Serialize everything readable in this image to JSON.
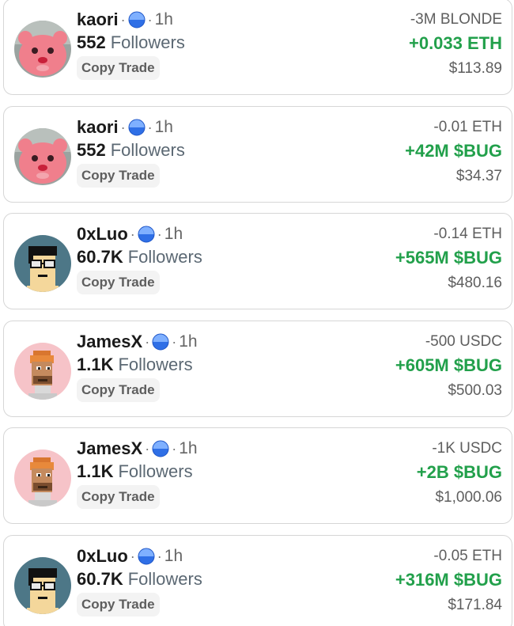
{
  "colors": {
    "positive": "#22a04b",
    "muted": "#5e5e5e",
    "verified_badge": "#2f6fe6"
  },
  "trades": [
    {
      "avatar": "kaori-pink-creature",
      "username": "kaori",
      "separator": "·",
      "time": "1h",
      "followers_count": "552",
      "followers_label": "Followers",
      "copy_label": "Copy Trade",
      "sold": "-3M BLONDE",
      "bought": "+0.033 ETH",
      "usd": "$113.89"
    },
    {
      "avatar": "kaori-pink-creature",
      "username": "kaori",
      "separator": "·",
      "time": "1h",
      "followers_count": "552",
      "followers_label": "Followers",
      "copy_label": "Copy Trade",
      "sold": "-0.01 ETH",
      "bought": "+42M $BUG",
      "usd": "$34.37"
    },
    {
      "avatar": "0xluo-pixel-glasses",
      "username": "0xLuo",
      "separator": "·",
      "time": "1h",
      "followers_count": "60.7K",
      "followers_label": "Followers",
      "copy_label": "Copy Trade",
      "sold": "-0.14 ETH",
      "bought": "+565M $BUG",
      "usd": "$480.16"
    },
    {
      "avatar": "jamesx-pixel-ape",
      "username": "JamesX",
      "separator": "·",
      "time": "1h",
      "followers_count": "1.1K",
      "followers_label": "Followers",
      "copy_label": "Copy Trade",
      "sold": "-500 USDC",
      "bought": "+605M $BUG",
      "usd": "$500.03"
    },
    {
      "avatar": "jamesx-pixel-ape",
      "username": "JamesX",
      "separator": "·",
      "time": "1h",
      "followers_count": "1.1K",
      "followers_label": "Followers",
      "copy_label": "Copy Trade",
      "sold": "-1K USDC",
      "bought": "+2B $BUG",
      "usd": "$1,000.06"
    },
    {
      "avatar": "0xluo-pixel-glasses",
      "username": "0xLuo",
      "separator": "·",
      "time": "1h",
      "followers_count": "60.7K",
      "followers_label": "Followers",
      "copy_label": "Copy Trade",
      "sold": "-0.05 ETH",
      "bought": "+316M $BUG",
      "usd": "$171.84"
    }
  ]
}
